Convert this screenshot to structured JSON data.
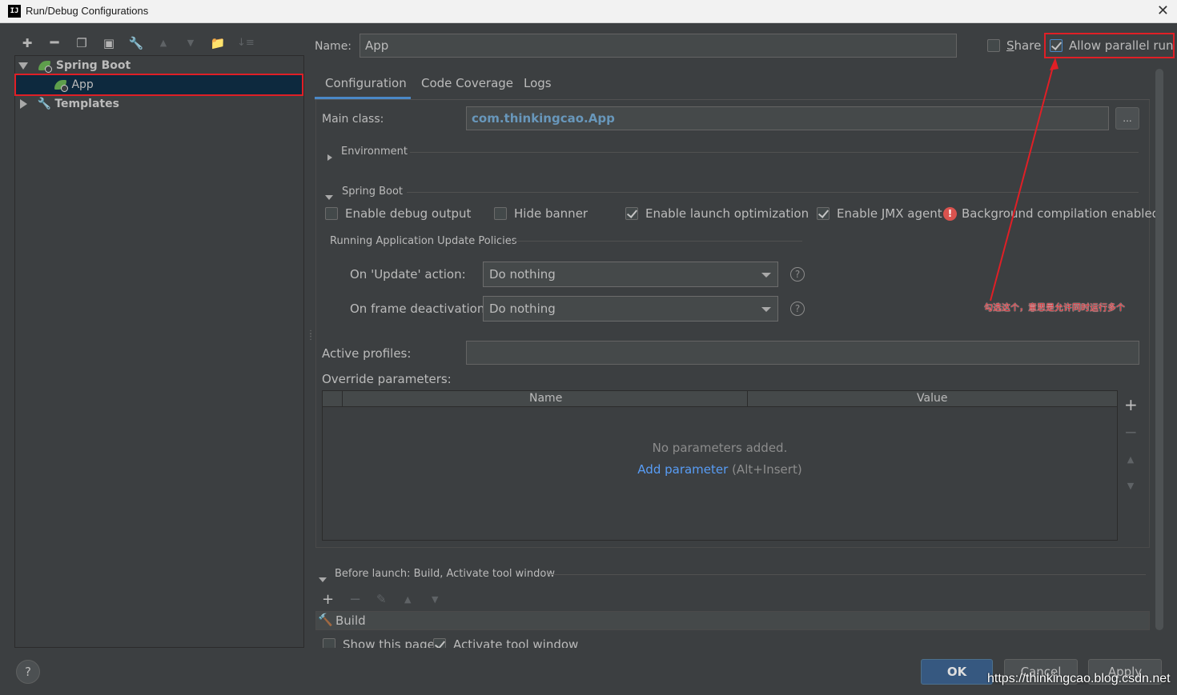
{
  "window": {
    "title": "Run/Debug Configurations"
  },
  "tree": {
    "spring_boot": "Spring Boot",
    "app": "App",
    "templates": "Templates"
  },
  "header": {
    "name_label": "Name:",
    "name_value": "App",
    "share_label": "Share",
    "share_checked": false,
    "allow_parallel_label": "Allow parallel run",
    "allow_parallel_checked": true
  },
  "tabs": [
    "Configuration",
    "Code Coverage",
    "Logs"
  ],
  "config": {
    "main_class_label": "Main class:",
    "main_class_value": "com.thinkingcao.App",
    "browse_label": "...",
    "environment_label": "Environment",
    "spring_boot_section": "Spring Boot",
    "checkboxes": [
      {
        "label": "Enable debug output",
        "checked": false
      },
      {
        "label": "Hide banner",
        "checked": false
      },
      {
        "label": "Enable launch optimization",
        "checked": true
      },
      {
        "label": "Enable JMX agent",
        "checked": true
      }
    ],
    "background_compilation": "Background compilation enabled",
    "update_policies_label": "Running Application Update Policies",
    "on_update_label": "On 'Update' action:",
    "on_update_value": "Do nothing",
    "on_frame_label": "On frame deactivation:",
    "on_frame_value": "Do nothing",
    "active_profiles_label": "Active profiles:",
    "active_profiles_value": "",
    "override_label": "Override parameters:",
    "table_headers": [
      "Name",
      "Value"
    ],
    "no_params": "No parameters added.",
    "add_param_link": "Add parameter",
    "add_param_shortcut": "(Alt+Insert)",
    "before_launch_label": "Before launch: Build, Activate tool window",
    "build_label": "Build",
    "show_page_label": "Show this page",
    "activate_tool_label": "Activate tool window"
  },
  "annotation": {
    "text": "勾选这个，意思是允许同时运行多个",
    "color": "#e01f26"
  },
  "footer": {
    "help": "?",
    "ok": "OK",
    "cancel": "Cancel",
    "apply": "Apply"
  },
  "watermark": "https://thinkingcao.blog.csdn.net",
  "colors": {
    "accent": "#4a88c7",
    "highlight_red": "#e01f26",
    "selection": "#0d293e",
    "ok_button": "#365880",
    "link": "#589df6"
  }
}
